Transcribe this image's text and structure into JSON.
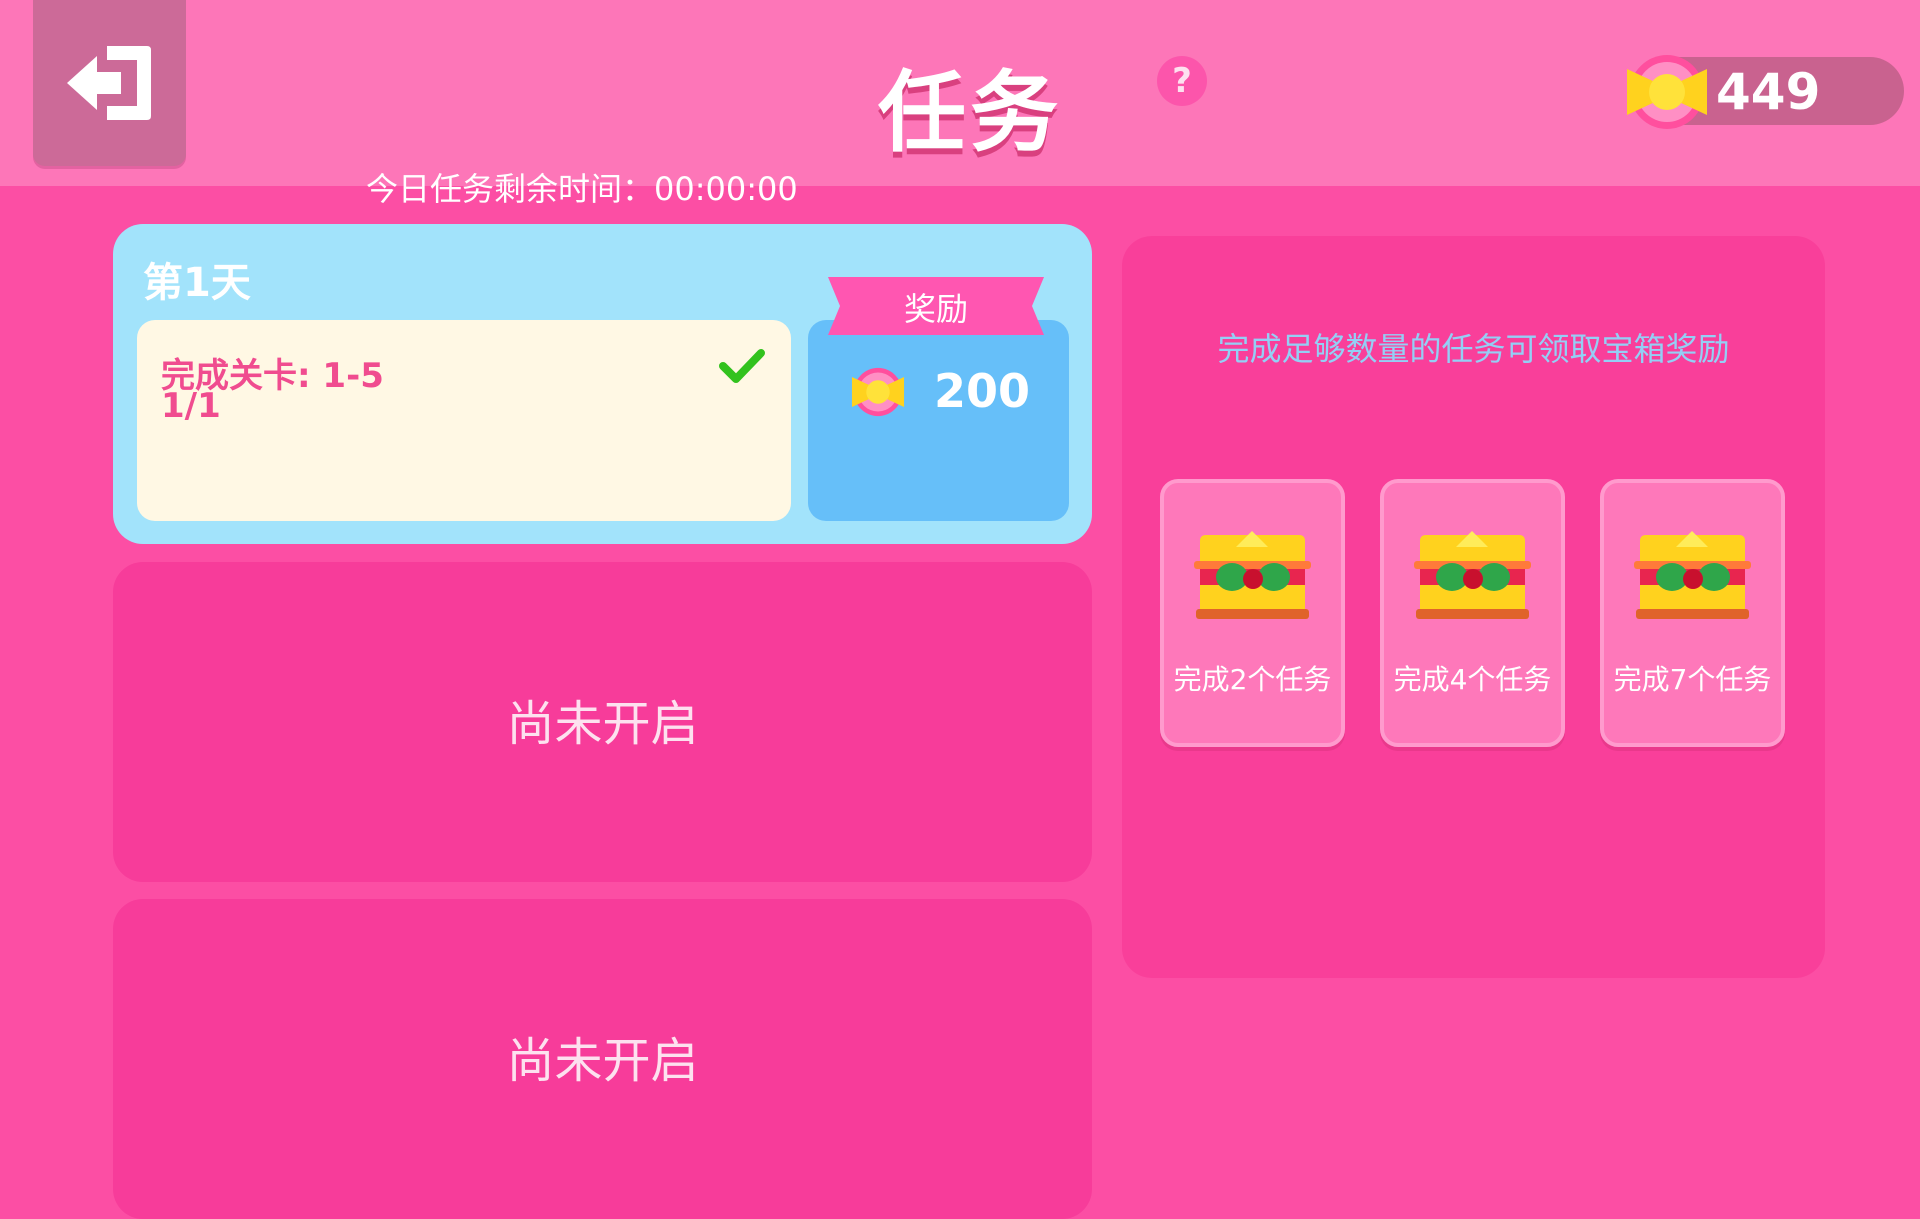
{
  "header": {
    "title": "任务",
    "help_label": "?",
    "coin_balance": "449"
  },
  "timer_text": "今日任务剩余时间：00:00:00",
  "day_card": {
    "title": "第1天",
    "task_name": "完成关卡: 1-5",
    "task_progress": "1/1",
    "reward_label": "奖励",
    "reward_amount": "200"
  },
  "locked_cards": [
    {
      "text": "尚未开启"
    },
    {
      "text": "尚未开启"
    }
  ],
  "chest_panel": {
    "hint": "完成足够数量的任务可领取宝箱奖励",
    "chests": [
      {
        "label": "完成2个任务"
      },
      {
        "label": "完成4个任务"
      },
      {
        "label": "完成7个任务"
      }
    ]
  },
  "colors": {
    "background": "#fc4ea4",
    "header": "#fd76b8",
    "day_card": "#a2e3fb",
    "reward_box": "#66bff9",
    "task_text": "#f04c8f",
    "accent_green": "#32c21d"
  },
  "icons": [
    "exit-icon",
    "help-icon",
    "candy-coin-icon",
    "check-icon",
    "treasure-chest-icon"
  ]
}
